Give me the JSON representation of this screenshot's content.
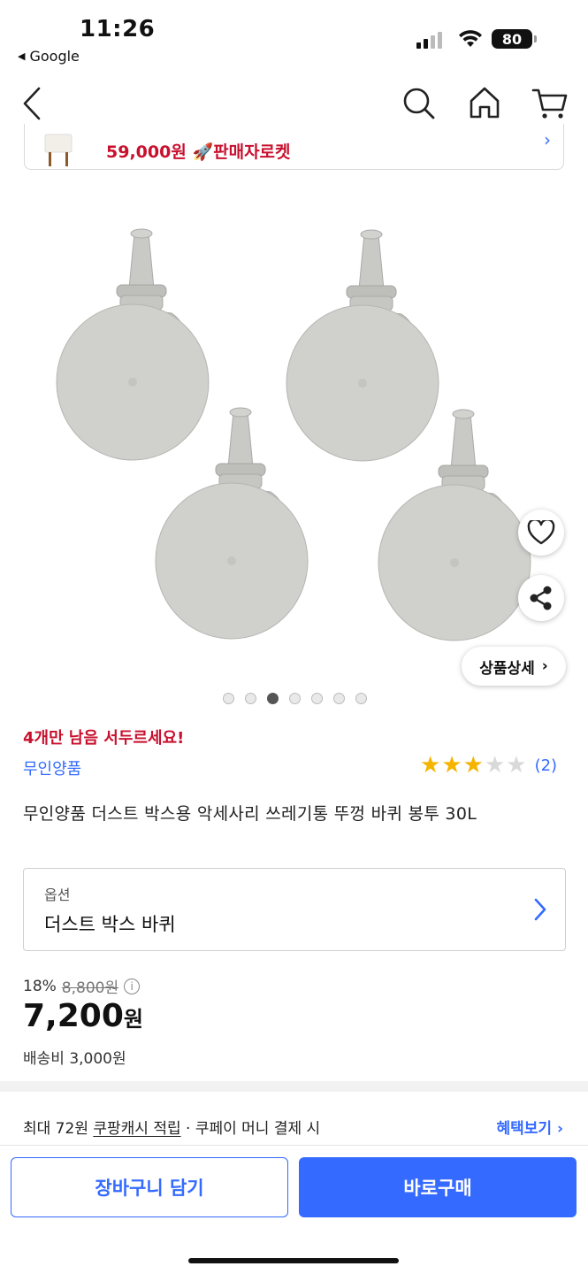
{
  "status_bar": {
    "time": "11:26",
    "back_app_label": "Google",
    "battery": "80"
  },
  "nav": {
    "icons": [
      "back-icon",
      "search-icon",
      "home-icon",
      "cart-icon"
    ]
  },
  "mini_card": {
    "price": "59,000원",
    "delivery_badge": "판매자로켓"
  },
  "gallery": {
    "page_count": 7,
    "active_index": 2,
    "detail_button": "상품상세"
  },
  "product": {
    "stock_alert": "4개만 남음 서두르세요!",
    "brand": "무인양품",
    "rating": 3,
    "rating_max": 5,
    "review_count": "(2)",
    "title": "무인양품 더스트 박스용 악세사리 쓰레기통 뚜껑 바퀴 봉투 30L"
  },
  "option": {
    "label": "옵션",
    "value": "더스트 박스 바퀴"
  },
  "pricing": {
    "discount_rate": "18%",
    "original_price": "8,800원",
    "price_number": "7,200",
    "price_unit": "원",
    "shipping": "배송비 3,000원"
  },
  "cashback": {
    "text_prefix": "최대 72원 ",
    "text_link": "쿠팡캐시 적립",
    "text_suffix": " · 쿠페이 머니 결제 시",
    "benefit_link": "혜택보기"
  },
  "actions": {
    "add_to_cart": "장바구니 담기",
    "buy_now": "바로구매"
  },
  "colors": {
    "accent_blue": "#346aff",
    "alert_red": "#c8102e",
    "star_yellow": "#f5b400"
  }
}
